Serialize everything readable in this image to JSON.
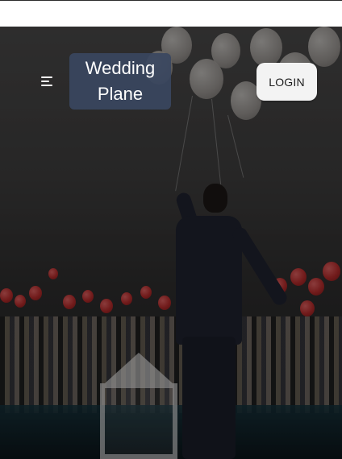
{
  "header": {
    "brand": "Wedding Plane",
    "login_label": "LOGIN",
    "menu_icon": "hamburger-menu-icon"
  },
  "colors": {
    "brand_box": "#3A465F",
    "login_bg": "#F3F3F3",
    "hero_overlay": "#000000"
  }
}
